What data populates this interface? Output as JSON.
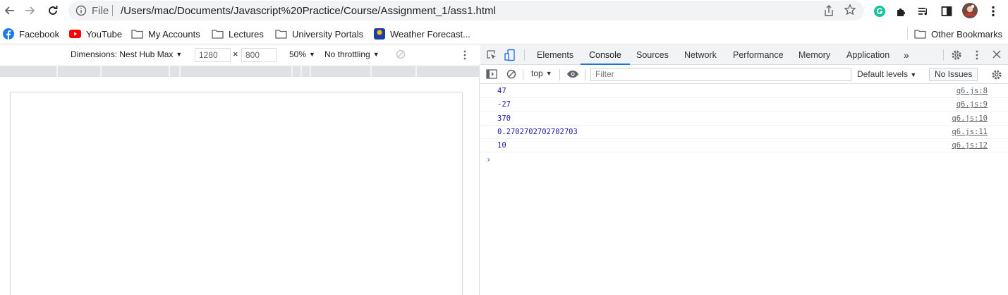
{
  "browser": {
    "address": {
      "scheme_label": "File",
      "url": "/Users/mac/Documents/Javascript%20Practice/Course/Assignment_1/ass1.html"
    },
    "icons": [
      "back-icon",
      "forward-icon",
      "reload-icon",
      "info-icon",
      "share-icon",
      "star-icon",
      "grammarly-icon",
      "extensions-icon",
      "media-icon",
      "sidepanel-icon",
      "profile-avatar",
      "menu-icon"
    ],
    "colors": {
      "grammarly": "#15c39a",
      "youtube": "#ff0000",
      "facebook": "#1877f2"
    }
  },
  "bookmarks": {
    "items": [
      {
        "label": "Facebook",
        "icon": "facebook-icon"
      },
      {
        "label": "YouTube",
        "icon": "youtube-icon"
      },
      {
        "label": "My Accounts",
        "icon": "folder-icon"
      },
      {
        "label": "Lectures",
        "icon": "folder-icon"
      },
      {
        "label": "University Portals",
        "icon": "folder-icon"
      },
      {
        "label": "Weather Forecast...",
        "icon": "weather-icon"
      }
    ],
    "other": "Other Bookmarks"
  },
  "device_toolbar": {
    "dimensions": "Dimensions: Nest Hub Max",
    "width": "1280",
    "times": "×",
    "height": "800",
    "zoom": "50%",
    "throttling": "No throttling"
  },
  "devtools": {
    "tabs": [
      "Elements",
      "Console",
      "Sources",
      "Network",
      "Performance",
      "Memory",
      "Application"
    ],
    "active_tab": "Console",
    "more_tabs": "»",
    "context": "top",
    "filter_placeholder": "Filter",
    "levels": "Default levels",
    "issues": "No Issues"
  },
  "console": {
    "messages": [
      {
        "text": "47",
        "source": "q6.js:8"
      },
      {
        "text": "-27",
        "source": "q6.js:9"
      },
      {
        "text": "370",
        "source": "q6.js:10"
      },
      {
        "text": "0.2702702702702703",
        "source": "q6.js:11"
      },
      {
        "text": "10",
        "source": "q6.js:12"
      }
    ],
    "prompt": "›"
  }
}
